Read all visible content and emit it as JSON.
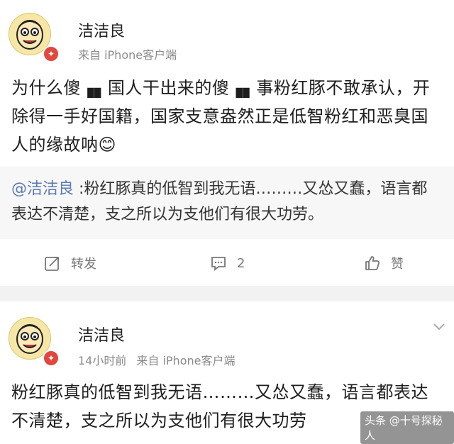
{
  "post": {
    "author": "洁洁良",
    "source": "来自 iPhone客户端",
    "text": "为什么傻▗▖国人干出来的傻▗▖事粉红豚不敢承认，开除得一手好国籍，国家支意盎然正是低智粉红和恶臭国人的缘故呐😊",
    "quote_mention": "@洁洁良",
    "quote_text": " :粉红豚真的低智到我无语………又怂又蠢，语言都表达不清楚，支之所以为支他们有很大功劳。",
    "actions": {
      "repost_label": "转发",
      "comment_count": "2",
      "like_label": "赞"
    }
  },
  "reply": {
    "author": "洁洁良",
    "time": "14小时前",
    "source": "来自 iPhone客户端",
    "text": "粉红豚真的低智到我无语………又怂又蠢，语言都表达不清楚，支之所以为支他们有很大功劳"
  },
  "watermark": "头条 @十号探秘人",
  "icons": {
    "verified_badge": "verified-badge-icon",
    "repost": "repost-icon",
    "comment": "comment-icon",
    "like": "thumbs-up-icon",
    "more": "chevron-down-icon"
  },
  "colors": {
    "mention": "#5b7bb0",
    "meta": "#8a8a8a",
    "badge": "#e1473d",
    "separator": "#f2f2f2"
  }
}
